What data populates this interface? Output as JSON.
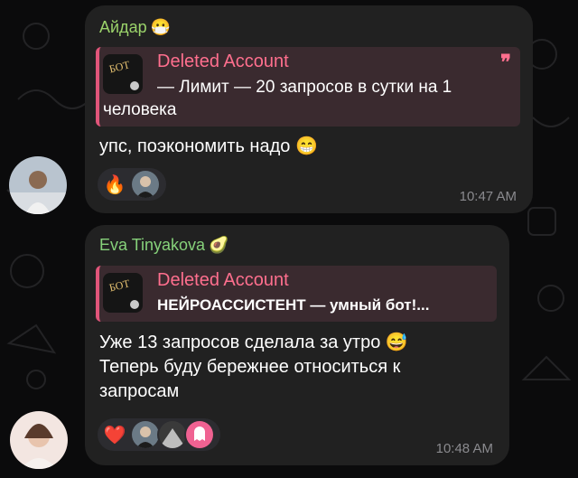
{
  "messages": [
    {
      "sender": "Айдар",
      "sender_emoji": "😷",
      "sender_color": "#9bd36a",
      "reply": {
        "name": "Deleted Account",
        "thumb_label": "БОТ",
        "text_line1": "— Лимит — 20 запросов в сутки на 1",
        "text_line2": "человека"
      },
      "text": "упс, поэкономить надо 😁",
      "reactions": [
        "🔥"
      ],
      "time": "10:47 AM"
    },
    {
      "sender": "Eva Tinyakova",
      "sender_emoji": "🥑",
      "sender_color": "#86d17a",
      "reply": {
        "name": "Deleted Account",
        "thumb_label": "БОТ",
        "text_line1": "НЕЙРОАССИСТЕНТ — умный бот!..."
      },
      "text_line1": "Уже 13 запросов сделала за утро 😅",
      "text_line2": "Теперь буду бережнее относиться к",
      "text_line3": "запросам",
      "reactions": [
        "❤️"
      ],
      "time": "10:48 AM"
    }
  ],
  "colors": {
    "reply_accent": "#e1557a",
    "bubble": "#212121",
    "background": "#0b0b0c"
  }
}
